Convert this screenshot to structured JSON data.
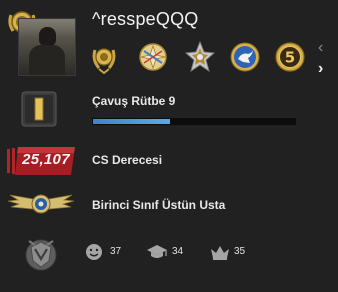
{
  "profile": {
    "username": "^resspeQQQ"
  },
  "nav": {
    "prev_icon": "chevron-left-icon",
    "next_icon": "chevron-right-icon"
  },
  "medals": [
    {
      "name": "gold-laurel-medal-icon"
    },
    {
      "name": "compass-star-coin-icon"
    },
    {
      "name": "silver-star-pin-icon"
    },
    {
      "name": "blue-bird-coin-icon"
    },
    {
      "name": "service-medal-5-icon"
    }
  ],
  "rank": {
    "label": "Çavuş Rütbe 9",
    "progress_fraction": 0.38
  },
  "rating": {
    "value": "25,107",
    "label": "CS Derecesi"
  },
  "skill_group": {
    "label": "Birinci Sınıf Üstün Usta"
  },
  "commendations": {
    "friendly": "37",
    "teacher": "34",
    "leader": "35"
  },
  "colors": {
    "background": "#212121",
    "progress_blue": "#4a9bdd",
    "rating_red": "#b51e24",
    "gold": "#d2b04a"
  }
}
